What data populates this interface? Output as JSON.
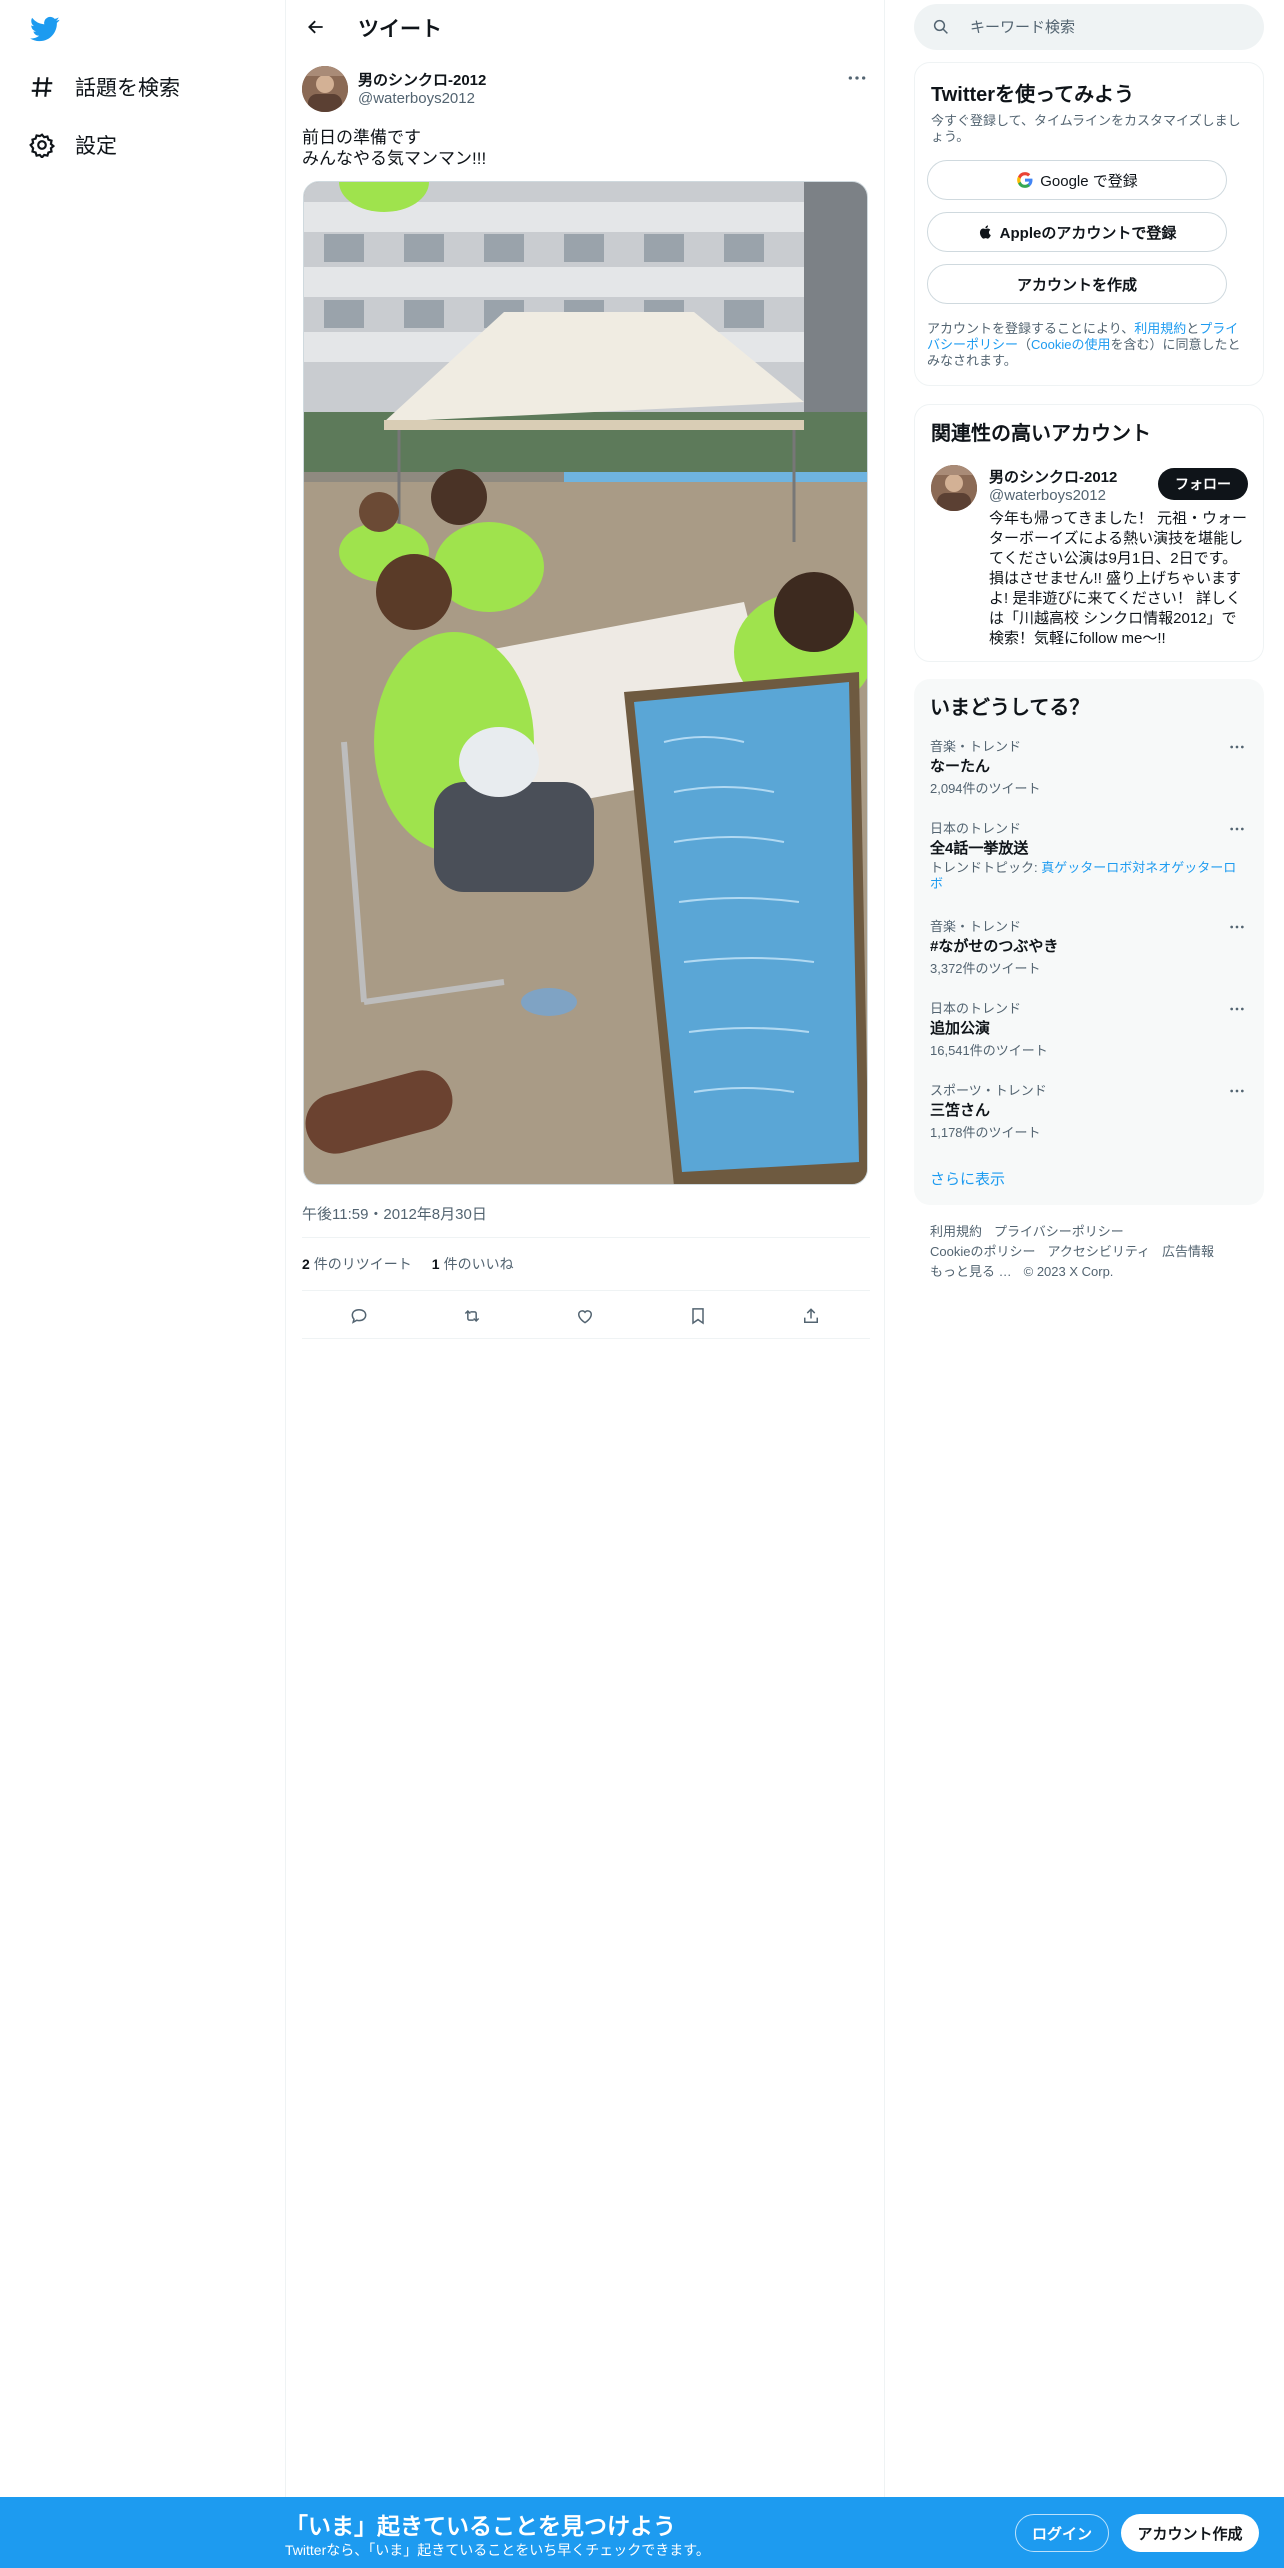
{
  "nav": {
    "logo_icon": "twitter-bird-icon",
    "items": [
      {
        "label": "話題を検索",
        "icon": "hashtag-icon"
      },
      {
        "label": "設定",
        "icon": "gear-icon"
      }
    ]
  },
  "header": {
    "title": "ツイート"
  },
  "tweet": {
    "author_name": "男のシンクロ-2012",
    "author_handle": "@waterboys2012",
    "text_lines": [
      "前日の準備です",
      "みんなやる気マンマン!!!"
    ],
    "timestamp": "午後11:59・2012年8月30日",
    "retweets_count": "2",
    "retweets_label": "件のリツイート",
    "likes_count": "1",
    "likes_label": "件のいいね"
  },
  "search": {
    "placeholder": "キーワード検索"
  },
  "signup_card": {
    "title": "Twitterを使ってみよう",
    "subtitle": "今すぐ登録して、タイムラインをカスタマイズしましょう。",
    "google_button": "Google で登録",
    "apple_button": "Appleのアカウントで登録",
    "create_button": "アカウントを作成",
    "legal_prefix": "アカウントを登録することにより、",
    "legal_terms": "利用規約",
    "legal_and": "と",
    "legal_privacy": "プライバシーポリシー",
    "legal_open": "（",
    "legal_cookie": "Cookieの使用",
    "legal_suffix": "を含む）に同意したとみなされます。"
  },
  "related": {
    "title": "関連性の高いアカウント",
    "name": "男のシンクロ-2012",
    "handle": "@waterboys2012",
    "follow_label": "フォロー",
    "bio": "今年も帰ってきました！ 元祖・ウォーターボーイズによる熱い演技を堪能してください公演は9月1日、2日です。損はさせません!! 盛り上げちゃいますよ! 是非遊びに来てください！ 詳しくは「川越高校 シンクロ情報2012」で検索！気軽にfollow me～!!"
  },
  "trends": {
    "title": "いまどうしてる？",
    "items": [
      {
        "meta": "音楽・トレンド",
        "name": "なーたん",
        "count": "2,094件のツイート"
      },
      {
        "meta": "日本のトレンド",
        "name": "全4話一挙放送",
        "topic_prefix": "トレンドトピック: ",
        "topic": "真ゲッターロボ対ネオゲッターロボ"
      },
      {
        "meta": "音楽・トレンド",
        "name": "#ながせのつぶやき",
        "count": "3,372件のツイート"
      },
      {
        "meta": "日本のトレンド",
        "name": "追加公演",
        "count": "16,541件のツイート"
      },
      {
        "meta": "スポーツ・トレンド",
        "name": "三笘さん",
        "count": "1,178件のツイート"
      }
    ],
    "show_more": "さらに表示"
  },
  "footer": {
    "links": [
      "利用規約",
      "プライバシーポリシー",
      "Cookieのポリシー",
      "アクセシビリティ",
      "広告情報",
      "もっと見る …"
    ],
    "copyright": "© 2023 X Corp."
  },
  "banner": {
    "title": "「いま」起きていることを見つけよう",
    "subtitle": "Twitterなら、「いま」起きていることをいち早くチェックできます。",
    "login": "ログイン",
    "signup": "アカウント作成"
  },
  "colors": {
    "accent": "#1d9bf0",
    "text": "#0f1419",
    "muted": "#536471"
  }
}
